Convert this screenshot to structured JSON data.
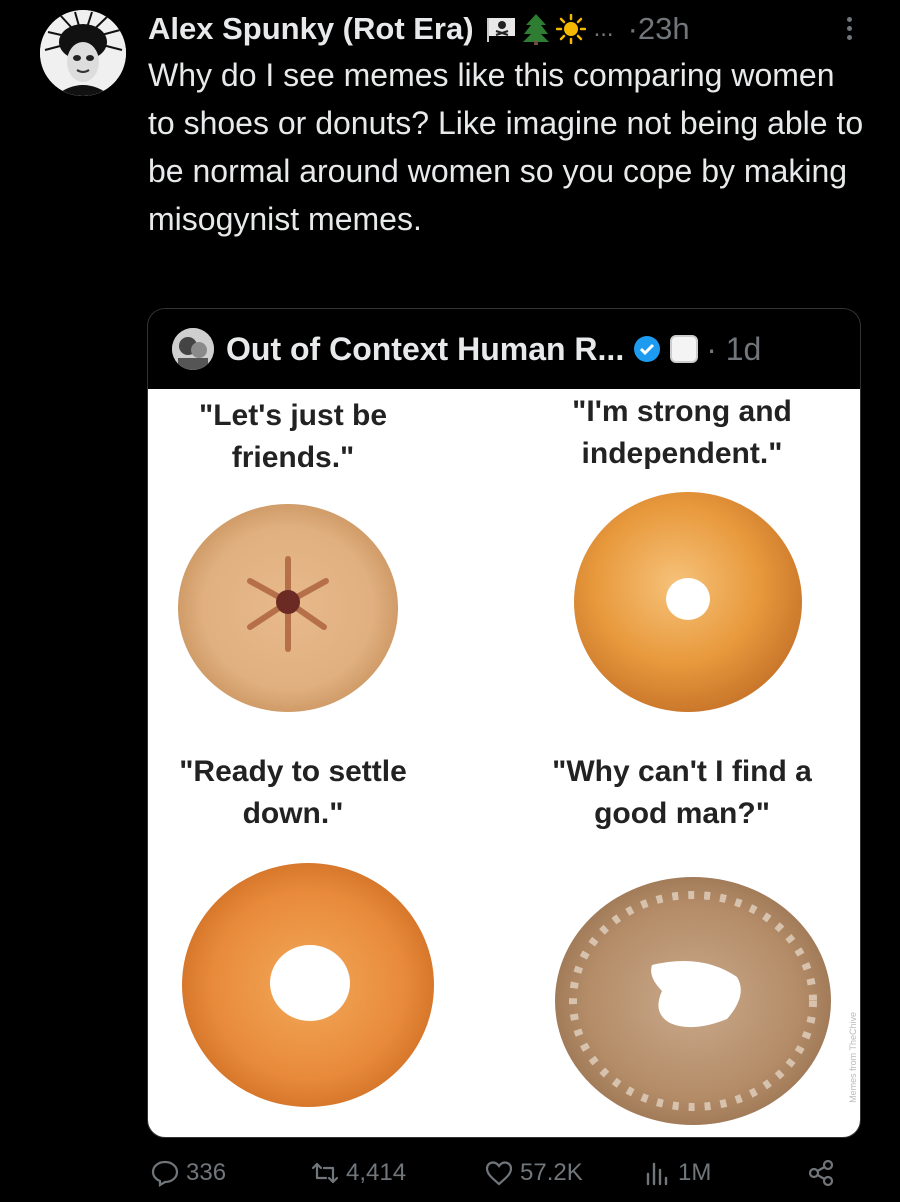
{
  "post": {
    "author": "Alex Spunky (Rot Era)",
    "badges": [
      "pirate-flag-emoji",
      "evergreen-tree-emoji",
      "sun-emoji"
    ],
    "ellipsis": "...",
    "separator": "·",
    "time": "23h",
    "text": "Why do I see memes like this comparing women to shoes or donuts? Like imagine not being able to be normal around women so you cope by making misogynist memes."
  },
  "quote": {
    "author": "Out of Context Human R...",
    "separator": "·",
    "time": "1d",
    "verified_color": "#1d9bf0",
    "meme": {
      "panels": [
        {
          "caption": "\"Let's just be friends.\"",
          "donut": "jelly-filled-donut"
        },
        {
          "caption": "\"I'm strong and independent.\"",
          "donut": "glazed-donut"
        },
        {
          "caption": "\"Ready to settle down.\"",
          "donut": "glazed-donut"
        },
        {
          "caption": "\"Why can't I find a good man?\"",
          "donut": "old-crumbly-donut"
        }
      ],
      "watermark": "Memes from TheChive"
    }
  },
  "actions": {
    "replies": "336",
    "reposts": "4,414",
    "likes": "57.2K",
    "views": "1M"
  },
  "colors": {
    "background": "#000000",
    "text": "#e7e9ea",
    "muted": "#71767b",
    "border": "#2f3336"
  }
}
